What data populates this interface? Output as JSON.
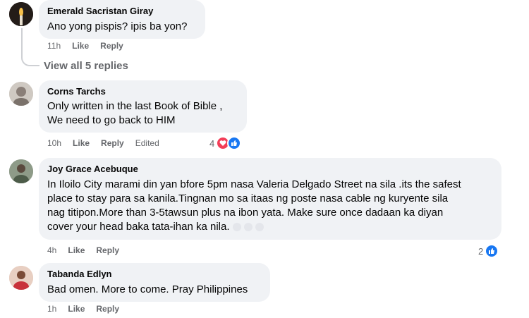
{
  "comments": [
    {
      "author": "Emerald Sacristan Giray",
      "text": "Ano yong pispis? ipis ba yon?",
      "time": "11h",
      "like": "Like",
      "reply": "Reply"
    },
    {
      "author": "Corns Tarchs",
      "text": "Only written in the last Book of Bible ,\nWe need to go back to HIM",
      "time": "10h",
      "like": "Like",
      "reply": "Reply",
      "edited": "Edited",
      "reaction_count": "4",
      "reactions": [
        "heart-icon",
        "thumbs-up-icon"
      ]
    },
    {
      "author": "Joy Grace Acebuque",
      "text": "In Iloilo City marami din yan bfore 5pm nasa Valeria Delgado Street na sila .its the safest\nplace to stay para sa kanila.Tingnan mo sa itaas ng poste nasa cable ng kuryente sila\nnag titipon.More than 3-5tawsun plus na ibon yata. Make sure once dadaan ka diyan\ncover your head baka tata-ihan ka nila.",
      "time": "4h",
      "like": "Like",
      "reply": "Reply",
      "reaction_count": "2",
      "reactions": [
        "thumbs-up-icon"
      ]
    },
    {
      "author": "Tabanda Edlyn",
      "text": "Bad omen. More to come. Pray Philippines",
      "time": "1h",
      "like": "Like",
      "reply": "Reply"
    }
  ],
  "view_replies": "View all 5 replies",
  "colors": {
    "bubble": "#f0f2f5",
    "meta": "#65676b",
    "like_blue": "#1877f2",
    "heart_red": "#f33e58"
  }
}
